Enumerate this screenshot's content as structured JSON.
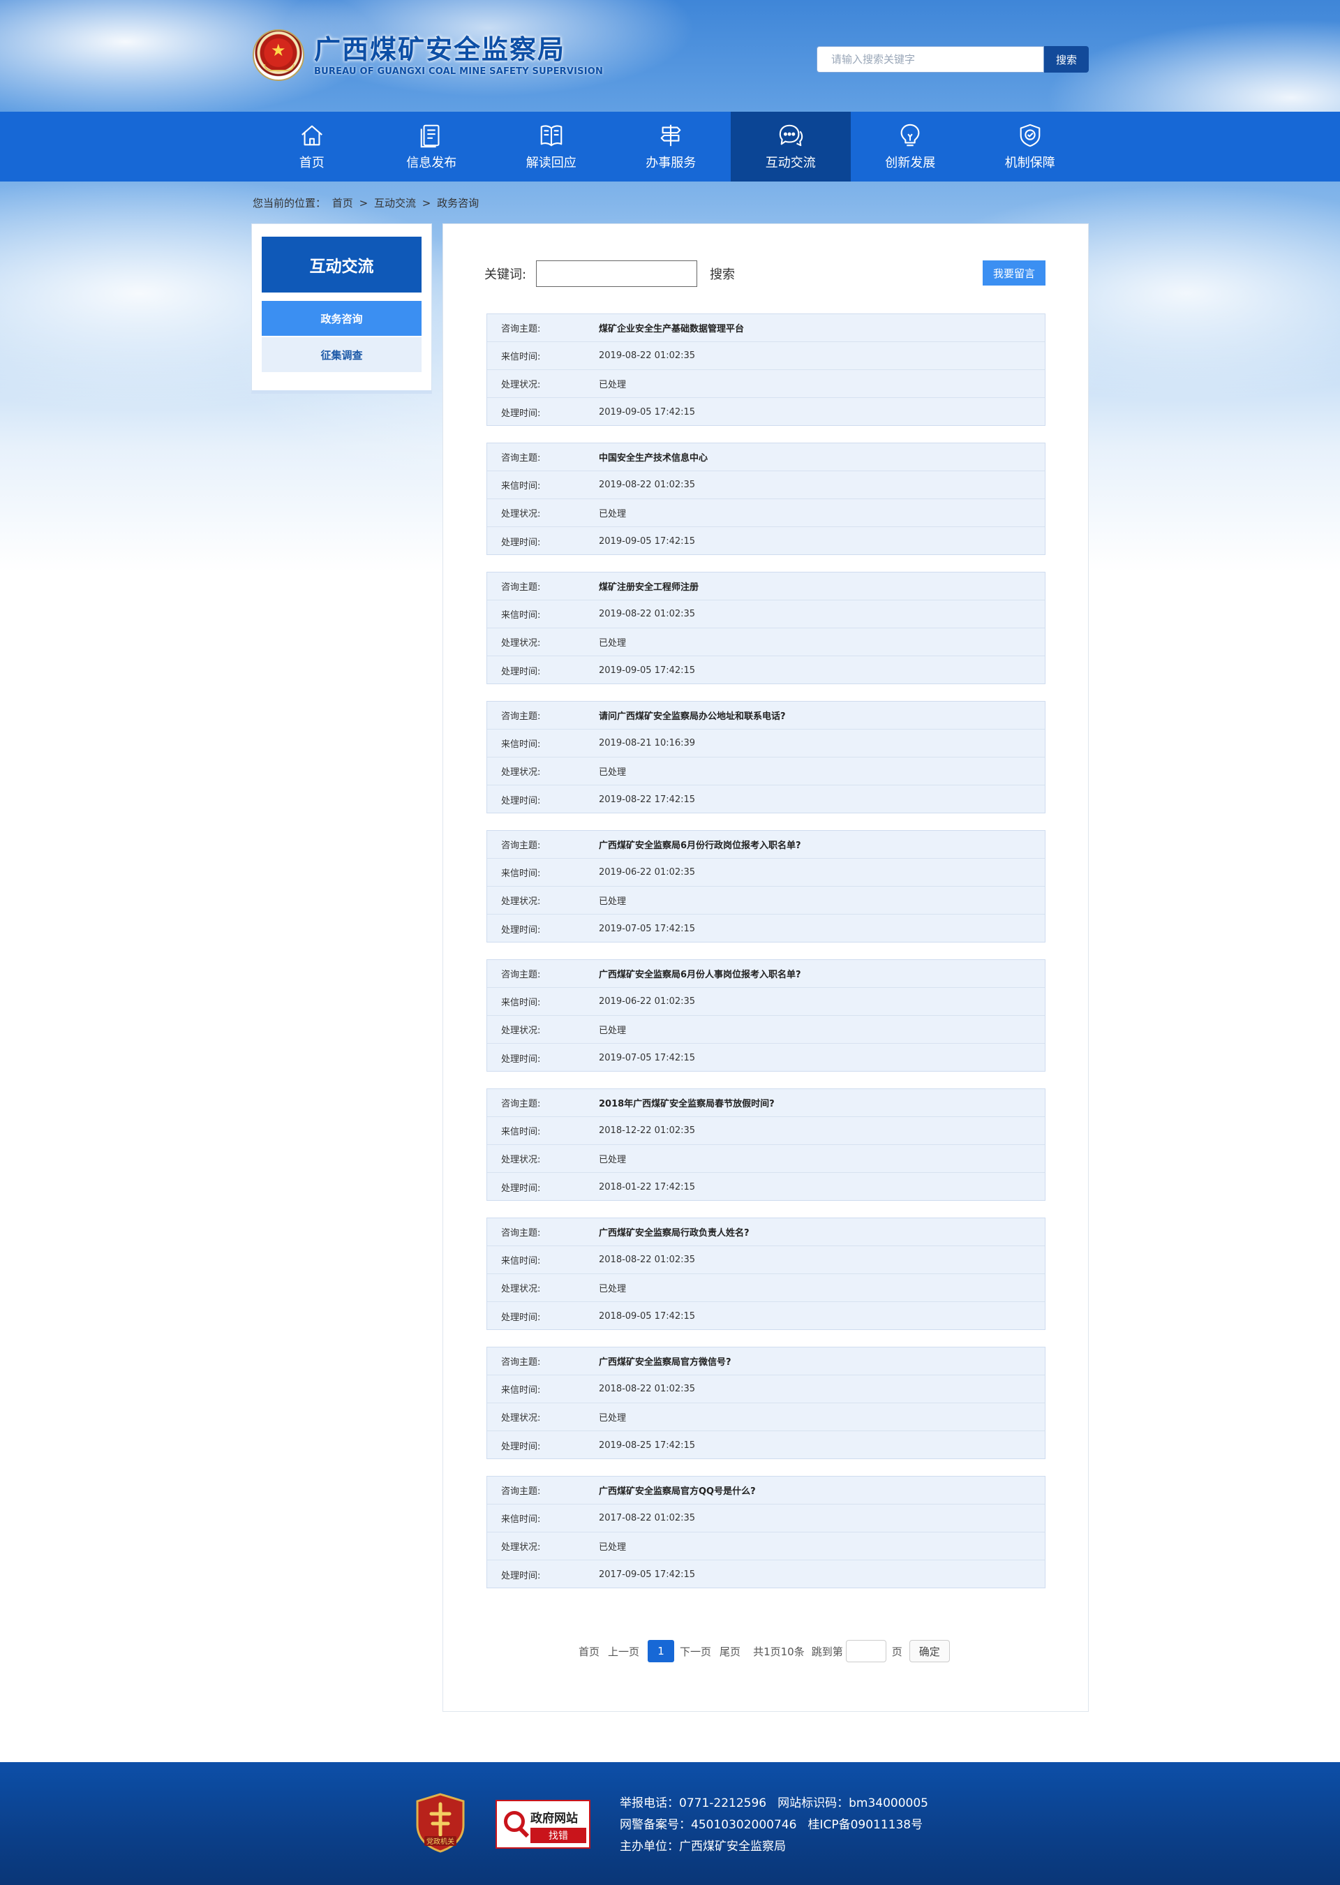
{
  "header": {
    "title_cn": "广西煤矿安全监察局",
    "title_en": "BUREAU OF GUANGXI COAL MINE SAFETY SUPERVISION",
    "search_placeholder": "请输入搜索关键字",
    "search_button": "搜索"
  },
  "nav": [
    {
      "label": "首页",
      "icon": "home-icon"
    },
    {
      "label": "信息发布",
      "icon": "document-icon"
    },
    {
      "label": "解读回应",
      "icon": "book-icon"
    },
    {
      "label": "办事服务",
      "icon": "signpost-icon"
    },
    {
      "label": "互动交流",
      "icon": "chat-icon"
    },
    {
      "label": "创新发展",
      "icon": "lightbulb-icon"
    },
    {
      "label": "机制保障",
      "icon": "shield-check-icon"
    }
  ],
  "breadcrumb": {
    "prefix": "您当前的位置：",
    "items": [
      "首页",
      ">",
      "互动交流",
      ">",
      "政务咨询"
    ]
  },
  "sidebar": {
    "title": "互动交流",
    "items": [
      "政务咨询",
      "征集调查"
    ]
  },
  "search_bar": {
    "keyword_label": "关键词:",
    "search_label": "搜索",
    "leave_message": "我要留言"
  },
  "labels": {
    "subject": "咨询主题:",
    "received": "来信时间:",
    "status": "处理状况:",
    "handled": "处理时间:"
  },
  "records": [
    {
      "subject": "煤矿企业安全生产基础数据管理平台",
      "received": "2019-08-22 01:02:35",
      "status": "已处理",
      "handled": "2019-09-05 17:42:15"
    },
    {
      "subject": "中国安全生产技术信息中心",
      "received": "2019-08-22 01:02:35",
      "status": "已处理",
      "handled": "2019-09-05 17:42:15"
    },
    {
      "subject": "煤矿注册安全工程师注册",
      "received": "2019-08-22 01:02:35",
      "status": "已处理",
      "handled": "2019-09-05 17:42:15"
    },
    {
      "subject": "请问广西煤矿安全监察局办公地址和联系电话?",
      "received": "2019-08-21 10:16:39",
      "status": "已处理",
      "handled": "2019-08-22 17:42:15"
    },
    {
      "subject": "广西煤矿安全监察局6月份行政岗位报考入职名单?",
      "received": "2019-06-22 01:02:35",
      "status": "已处理",
      "handled": "2019-07-05 17:42:15"
    },
    {
      "subject": "广西煤矿安全监察局6月份人事岗位报考入职名单?",
      "received": "2019-06-22 01:02:35",
      "status": "已处理",
      "handled": "2019-07-05 17:42:15"
    },
    {
      "subject": "2018年广西煤矿安全监察局春节放假时间?",
      "received": "2018-12-22 01:02:35",
      "status": "已处理",
      "handled": "2018-01-22 17:42:15"
    },
    {
      "subject": "广西煤矿安全监察局行政负责人姓名?",
      "received": "2018-08-22 01:02:35",
      "status": "已处理",
      "handled": "2018-09-05 17:42:15"
    },
    {
      "subject": "广西煤矿安全监察局官方微信号?",
      "received": "2018-08-22 01:02:35",
      "status": "已处理",
      "handled": "2019-08-25 17:42:15"
    },
    {
      "subject": "广西煤矿安全监察局官方QQ号是什么?",
      "received": "2017-08-22 01:02:35",
      "status": "已处理",
      "handled": "2017-09-05 17:42:15"
    }
  ],
  "pagination": {
    "first": "首页",
    "prev": "上一页",
    "current": "1",
    "next": "下一页",
    "last": "尾页",
    "summary": "共1页10条",
    "jump_to": "跳到第",
    "page_unit": "页",
    "confirm": "确定"
  },
  "footer": {
    "badge1_label": "党政机关",
    "badge2_title": "政府网站",
    "badge2_label": "找错",
    "report_phone": "举报电话：0771-2212596",
    "site_id": "网站标识码：bm34000005",
    "police_record": "网警备案号：45010302000746",
    "icp": "桂ICP备09011138号",
    "host": "主办单位：广西煤矿安全监察局"
  },
  "colors": {
    "nav_bg": "#1768d6",
    "nav_active": "#0b4595",
    "accent_button": "#3b8ff2",
    "footer_bg": "#0b3f89"
  }
}
